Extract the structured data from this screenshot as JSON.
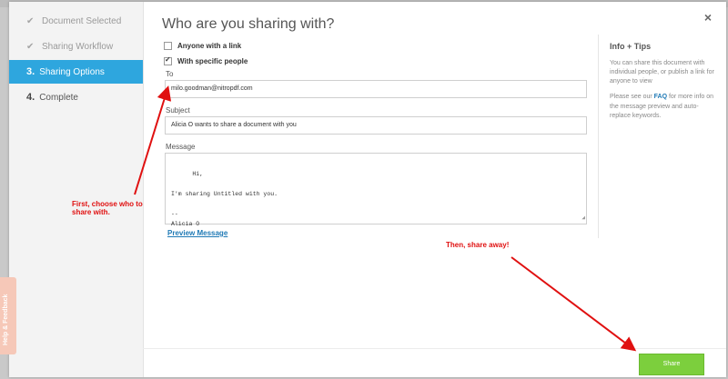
{
  "sidebar": {
    "steps": [
      {
        "label": "Document Selected",
        "icon": "check-icon"
      },
      {
        "label": "Sharing Workflow",
        "icon": "check-icon"
      },
      {
        "num": "3.",
        "label": "Sharing Options",
        "active": true
      },
      {
        "num": "4.",
        "label": "Complete"
      }
    ],
    "help_tab": "Help & Feedback"
  },
  "dialog": {
    "title": "Who are you sharing with?",
    "close": "×",
    "options": {
      "anyone_label": "Anyone with a link",
      "specific_label": "With specific people"
    },
    "fields": {
      "to_label": "To",
      "to_value": "milo.goodman@nitropdf.com",
      "subject_label": "Subject",
      "subject_value": "Alicia O wants to share a document with you",
      "message_label": "Message",
      "message_value": "Hi,\n\nI'm sharing Untitled with you.\n\n--\nAlicia O"
    },
    "preview_link": "Preview Message",
    "share_button": "Share"
  },
  "tips": {
    "title": "Info + Tips",
    "p1": "You can share this document with individual people, or publish a link for anyone to view",
    "p2_pre": "Please see our ",
    "p2_faq": "FAQ",
    "p2_post": " for more info on the message preview and auto-replace keywords."
  },
  "annotations": {
    "first_line1": "First, choose who to",
    "first_line2": "share with.",
    "then": "Then, share away!"
  },
  "colors": {
    "active_step": "#2ea6de",
    "share_button": "#7ccf3d",
    "annotation": "#e01010",
    "link": "#1e79b5"
  }
}
